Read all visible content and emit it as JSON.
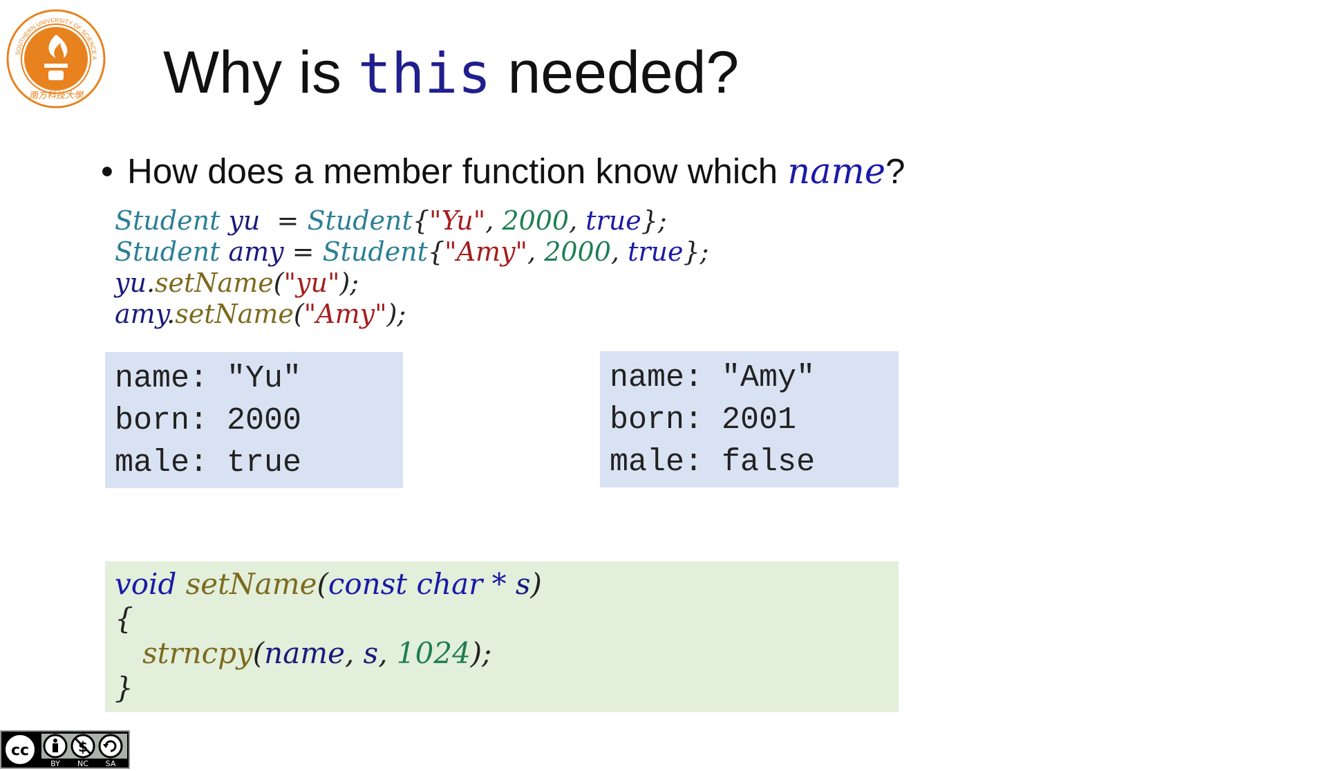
{
  "logo": {
    "alt_text": "SOUTHERN UNIVERSITY OF SCIENCE AND TECHNOLOGY",
    "chinese_name": "南方科技大學"
  },
  "title": {
    "before": "Why is ",
    "keyword": "this",
    "after": " needed?"
  },
  "bullet": {
    "dot": "•",
    "text_before": "How does a member function know which ",
    "highlight": "name",
    "text_after": "?"
  },
  "code_lines": [
    [
      {
        "t": "Student",
        "c": "ty"
      },
      {
        "t": " ",
        "c": "op"
      },
      {
        "t": "yu",
        "c": "id"
      },
      {
        "t": "  = ",
        "c": "op"
      },
      {
        "t": "Student",
        "c": "ty"
      },
      {
        "t": "{",
        "c": "op"
      },
      {
        "t": "\"Yu\"",
        "c": "st"
      },
      {
        "t": ", ",
        "c": "op"
      },
      {
        "t": "2000",
        "c": "nu"
      },
      {
        "t": ", ",
        "c": "op"
      },
      {
        "t": "true",
        "c": "kw2"
      },
      {
        "t": "};",
        "c": "op"
      }
    ],
    [
      {
        "t": "Student",
        "c": "ty"
      },
      {
        "t": " ",
        "c": "op"
      },
      {
        "t": "amy",
        "c": "id"
      },
      {
        "t": " = ",
        "c": "op"
      },
      {
        "t": "Student",
        "c": "ty"
      },
      {
        "t": "{",
        "c": "op"
      },
      {
        "t": "\"Amy\"",
        "c": "st"
      },
      {
        "t": ", ",
        "c": "op"
      },
      {
        "t": "2000",
        "c": "nu"
      },
      {
        "t": ", ",
        "c": "op"
      },
      {
        "t": "true",
        "c": "kw2"
      },
      {
        "t": "};",
        "c": "op"
      }
    ],
    [
      {
        "t": "yu",
        "c": "id"
      },
      {
        "t": ".",
        "c": "op"
      },
      {
        "t": "setName",
        "c": "fn"
      },
      {
        "t": "(",
        "c": "op"
      },
      {
        "t": "\"yu\"",
        "c": "st"
      },
      {
        "t": ");",
        "c": "op"
      }
    ],
    [
      {
        "t": "amy",
        "c": "id"
      },
      {
        "t": ".",
        "c": "op"
      },
      {
        "t": "setName",
        "c": "fn"
      },
      {
        "t": "(",
        "c": "op"
      },
      {
        "t": "\"Amy\"",
        "c": "st"
      },
      {
        "t": ");",
        "c": "op"
      }
    ]
  ],
  "object_yu": [
    {
      "field": "name:",
      "value": "\"Yu\""
    },
    {
      "field": "born:",
      "value": "2000"
    },
    {
      "field": "male:",
      "value": "true"
    }
  ],
  "object_amy": [
    {
      "field": "name:",
      "value": "\"Amy\""
    },
    {
      "field": "born:",
      "value": "2001"
    },
    {
      "field": "male:",
      "value": "false"
    }
  ],
  "function_lines": [
    [
      {
        "t": "void",
        "c": "kw2"
      },
      {
        "t": " ",
        "c": "op"
      },
      {
        "t": "setName",
        "c": "fn"
      },
      {
        "t": "(",
        "c": "op"
      },
      {
        "t": "const",
        "c": "kw2"
      },
      {
        "t": " ",
        "c": "op"
      },
      {
        "t": "char",
        "c": "kw2"
      },
      {
        "t": " * ",
        "c": "kw2"
      },
      {
        "t": "s",
        "c": "id"
      },
      {
        "t": ")",
        "c": "op"
      }
    ],
    [
      {
        "t": "{",
        "c": "op"
      }
    ],
    [
      {
        "t": "   ",
        "c": "op"
      },
      {
        "t": "strncpy",
        "c": "fn"
      },
      {
        "t": "(",
        "c": "op"
      },
      {
        "t": "name",
        "c": "id"
      },
      {
        "t": ", ",
        "c": "op"
      },
      {
        "t": "s",
        "c": "id"
      },
      {
        "t": ", ",
        "c": "op"
      },
      {
        "t": "1024",
        "c": "nu"
      },
      {
        "t": ");",
        "c": "op"
      }
    ],
    [
      {
        "t": "}",
        "c": "op"
      }
    ]
  ],
  "license": {
    "labels": [
      "BY",
      "NC",
      "SA"
    ]
  },
  "colors": {
    "object_box_bg": "#d9e2f3",
    "function_box_bg": "#e2efda",
    "logo_orange": "#e8821e"
  }
}
